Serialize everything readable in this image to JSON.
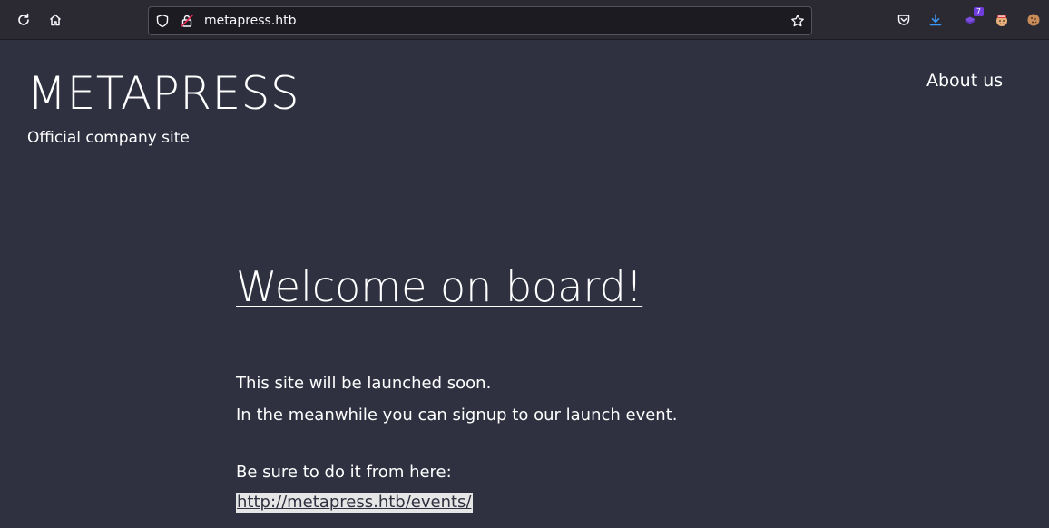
{
  "browser": {
    "url": "metapress.htb",
    "extension_badge": "7",
    "icons": {
      "reload": "reload-icon",
      "home": "home-icon",
      "shield": "shield-icon",
      "lock": "lock-icon",
      "bookmark": "star-icon",
      "pocket": "pocket-icon",
      "downloads": "download-icon",
      "extension": "extension-icon",
      "avatar": "avatar-icon",
      "cookie": "cookie-icon"
    },
    "colors": {
      "toolbar": "#2b2a33",
      "urlbar": "#1c1b22",
      "download": "#3b96f4",
      "badge": "#6e3ddb"
    }
  },
  "site": {
    "title": "METAPRESS",
    "tagline": "Official company site",
    "nav": {
      "about": "About us"
    }
  },
  "main": {
    "heading": "Welcome on board!",
    "line1": "This site will be launched soon.",
    "line2": "In the meanwhile you can signup to our launch event.",
    "line3": "Be sure to do it from here:",
    "events_link": "http://metapress.htb/events/"
  },
  "colors": {
    "page_bg": "#2f3040",
    "text": "#ffffff",
    "link_highlight": "#e6e6e6"
  }
}
